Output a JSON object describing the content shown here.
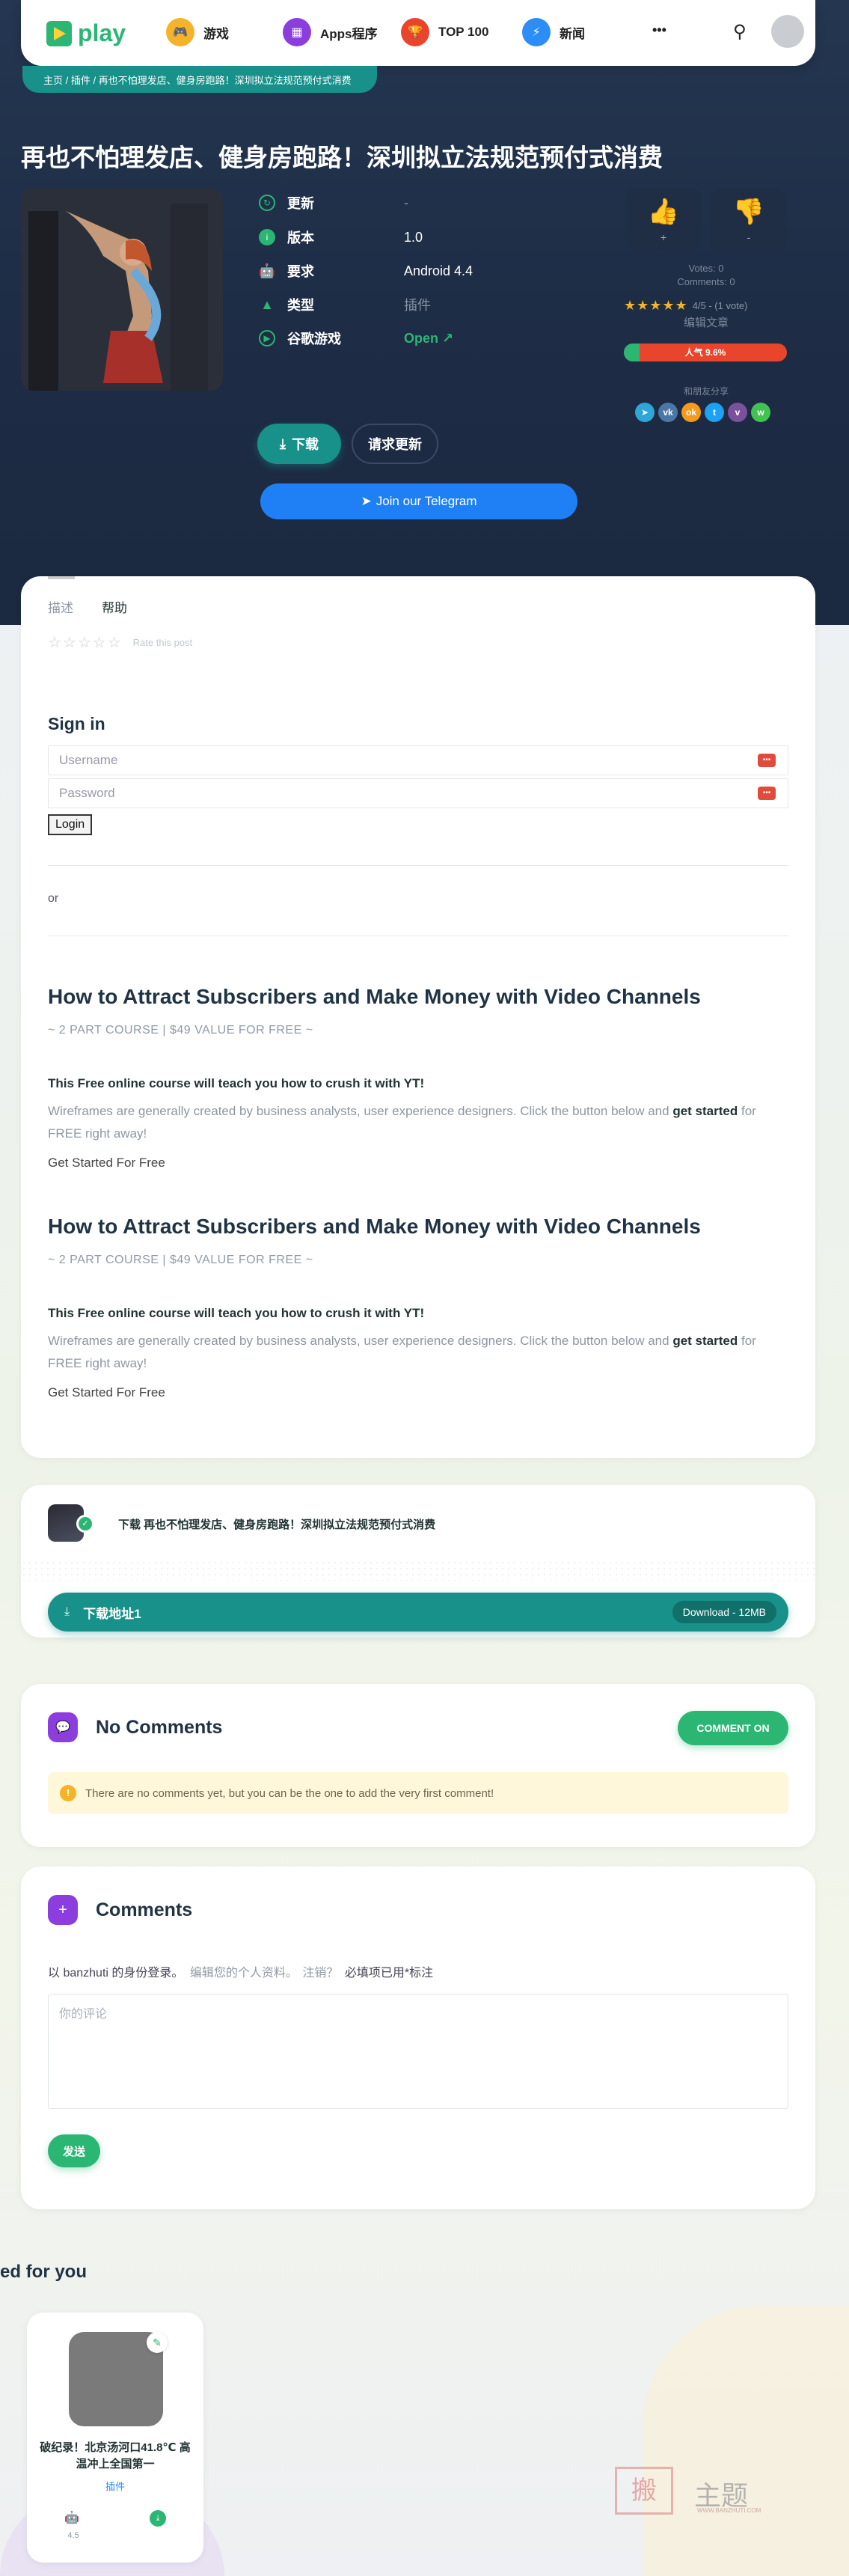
{
  "header": {
    "logo": "play",
    "nav": [
      {
        "label": "游戏",
        "icon": "gamepad-icon",
        "color": "#f5b32a"
      },
      {
        "label": "Apps程序",
        "icon": "grid-icon",
        "color": "#8b3dde"
      },
      {
        "label": "TOP 100",
        "icon": "trophy-icon",
        "color": "#e8452c"
      },
      {
        "label": "新闻",
        "icon": "bolt-icon",
        "color": "#2b8df5"
      }
    ],
    "more": "•••"
  },
  "breadcrumb": "主页 / 插件 / 再也不怕理发店、健身房跑路！深圳拟立法规范预付式消费",
  "post": {
    "title": "再也不怕理发店、健身房跑路！深圳拟立法规范预付式消费"
  },
  "info": [
    {
      "label": "更新",
      "value": "-",
      "icon": "refresh-icon"
    },
    {
      "label": "版本",
      "value": "1.0",
      "icon": "info-icon"
    },
    {
      "label": "要求",
      "value": "Android 4.4",
      "icon": "android-icon"
    },
    {
      "label": "类型",
      "value": "插件",
      "icon": "category-icon"
    },
    {
      "label": "谷歌游戏",
      "value": "Open ↗",
      "icon": "play-icon"
    }
  ],
  "votes": {
    "up": "+",
    "down": "-",
    "votes": "Votes: 0",
    "comments": "Comments: 0",
    "rating_text": "4/5 - (1 vote)",
    "edit": "编辑文章",
    "popularity": "人气 9.6%",
    "popularity_value": 9.6,
    "share_label": "和朋友分享"
  },
  "share": [
    {
      "icon": "telegram-icon",
      "color": "#2ea6d8",
      "glyph": "➤"
    },
    {
      "icon": "vk-icon",
      "color": "#4a76a8",
      "glyph": "vk"
    },
    {
      "icon": "ok-icon",
      "color": "#f59a1c",
      "glyph": "ok"
    },
    {
      "icon": "twitter-icon",
      "color": "#1da1f2",
      "glyph": "t"
    },
    {
      "icon": "viber-icon",
      "color": "#7b519d",
      "glyph": "v"
    },
    {
      "icon": "whatsapp-icon",
      "color": "#40c351",
      "glyph": "w"
    }
  ],
  "actions": {
    "download": "下载",
    "request": "请求更新",
    "telegram": "Join our Telegram"
  },
  "content": {
    "tabs": [
      "描述",
      "帮助"
    ],
    "rate": "Rate this post",
    "signin": {
      "heading": "Sign in",
      "username": "Username",
      "password": "Password",
      "login": "Login",
      "or": "or"
    },
    "sections": [
      {
        "title": "How to Attract Subscribers and Make Money with Video Channels",
        "sub": "~ 2 PART COURSE | $49 VALUE FOR FREE ~",
        "lead": "This Free online course will teach you how to crush it with YT!",
        "text_a": "Wireframes are generally created by business analysts, user experience designers. Click the button below and ",
        "text_b": "get started",
        "text_c": " for FREE right away!",
        "cta": "Get Started For Free"
      },
      {
        "title": "How to Attract Subscribers and Make Money with Video Channels",
        "sub": "~ 2 PART COURSE | $49 VALUE FOR FREE ~",
        "lead": "This Free online course will teach you how to crush it with YT!",
        "text_a": "Wireframes are generally created by business analysts, user experience designers. Click the button below and ",
        "text_b": "get started",
        "text_c": " for FREE right away!",
        "cta": "Get Started For Free"
      }
    ]
  },
  "download": {
    "title": "下载 再也不怕理发店、健身房跑路！深圳拟立法规范预付式消费",
    "link": "下载地址1",
    "size": "Download - 12MB"
  },
  "no_comments": {
    "title": "No Comments",
    "button": "COMMENT ON",
    "notice": "There are no comments yet, but you can be the one to add the very first comment!"
  },
  "comments": {
    "title": "Comments",
    "login_prefix": "以 ",
    "user": "banzhuti",
    "login_mid": " 的身份登录。",
    "edit": "编辑您的个人资料",
    "logout": "注销？",
    "required": "必填项已用*标注",
    "placeholder": "你的评论",
    "submit": "发送"
  },
  "recommend": {
    "heading": "ed for you",
    "item": {
      "title": "破纪录！北京汤河口41.8℃ 高温冲上全国第一",
      "category": "插件",
      "rating": "4.5"
    }
  },
  "watermark": {
    "text": "主题",
    "sub": "WWW.BANZHUTI.COM"
  }
}
